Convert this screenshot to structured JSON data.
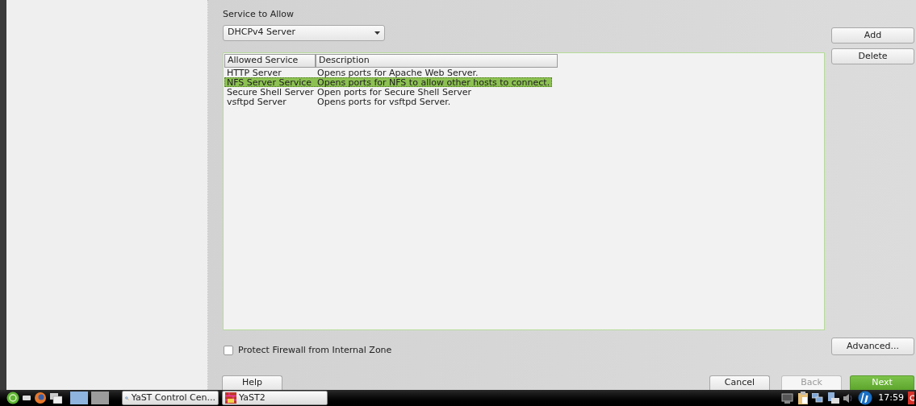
{
  "service_to_allow": {
    "label": "Service to Allow",
    "value": "DHCPv4 Server"
  },
  "side_buttons": [
    "Add",
    "Delete"
  ],
  "table": {
    "columns": [
      "Allowed Service",
      "Description"
    ],
    "rows": [
      {
        "service": "HTTP Server",
        "description": "Opens ports for Apache Web Server.",
        "selected": false
      },
      {
        "service": "NFS Server Service",
        "description": "Opens ports for NFS to allow other hosts to connect.",
        "selected": true
      },
      {
        "service": "Secure Shell Server",
        "description": "Open ports for Secure Shell Server",
        "selected": false
      },
      {
        "service": "vsftpd Server",
        "description": "Opens ports for vsftpd Server.",
        "selected": false
      }
    ]
  },
  "protect_firewall": {
    "label": "Protect Firewall from Internal Zone",
    "checked": false
  },
  "advanced_button": "Advanced...",
  "footer_buttons": [
    {
      "label": "Help",
      "kind": "normal"
    },
    {
      "label": "Cancel",
      "kind": "normal"
    },
    {
      "label": "Back",
      "kind": "disabled"
    },
    {
      "label": "Next",
      "kind": "primary"
    }
  ],
  "taskbar": {
    "tasks": [
      {
        "label": "YaST Control Cen...",
        "kind": "search"
      },
      {
        "label": "YaST2",
        "kind": "firewall"
      }
    ],
    "clock": "17:59"
  }
}
